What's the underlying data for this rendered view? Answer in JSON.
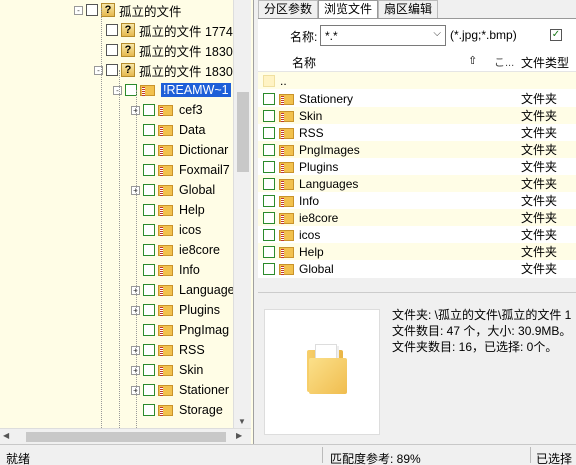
{
  "tree": {
    "items": [
      {
        "label": "孤立的文件",
        "kind": "q"
      },
      {
        "label": "孤立的文件 1774",
        "kind": "q"
      },
      {
        "label": "孤立的文件 1830",
        "kind": "q"
      },
      {
        "label": "孤立的文件 1830",
        "kind": "q"
      },
      {
        "label": "!REAMW~1",
        "kind": "folder",
        "selected": true
      },
      {
        "label": "cef3",
        "kind": "folder"
      },
      {
        "label": "Data",
        "kind": "folder"
      },
      {
        "label": "Dictionar",
        "kind": "folder"
      },
      {
        "label": "Foxmail7",
        "kind": "folder"
      },
      {
        "label": "Global",
        "kind": "folder"
      },
      {
        "label": "Help",
        "kind": "folder"
      },
      {
        "label": "icos",
        "kind": "folder"
      },
      {
        "label": "ie8core",
        "kind": "folder"
      },
      {
        "label": "Info",
        "kind": "folder"
      },
      {
        "label": "Language",
        "kind": "folder"
      },
      {
        "label": "Plugins",
        "kind": "folder"
      },
      {
        "label": "PngImag",
        "kind": "folder"
      },
      {
        "label": "RSS",
        "kind": "folder"
      },
      {
        "label": "Skin",
        "kind": "folder"
      },
      {
        "label": "Stationer",
        "kind": "folder"
      },
      {
        "label": "Storage",
        "kind": "folder"
      }
    ]
  },
  "tabs": [
    {
      "label": "分区参数",
      "active": false
    },
    {
      "label": "浏览文件",
      "active": true
    },
    {
      "label": "扇区编辑",
      "active": false
    }
  ],
  "filter": {
    "label": "名称:",
    "value": "*.*",
    "hint": "(*.jpg;*.bmp)"
  },
  "list": {
    "columns": {
      "name": "名称",
      "truncated": "こ...",
      "type": "文件类型"
    },
    "parent": "..",
    "rows": [
      {
        "name": "Stationery",
        "type": "文件夹"
      },
      {
        "name": "Skin",
        "type": "文件夹"
      },
      {
        "name": "RSS",
        "type": "文件夹"
      },
      {
        "name": "PngImages",
        "type": "文件夹"
      },
      {
        "name": "Plugins",
        "type": "文件夹"
      },
      {
        "name": "Languages",
        "type": "文件夹"
      },
      {
        "name": "Info",
        "type": "文件夹"
      },
      {
        "name": "ie8core",
        "type": "文件夹"
      },
      {
        "name": "icos",
        "type": "文件夹"
      },
      {
        "name": "Help",
        "type": "文件夹"
      },
      {
        "name": "Global",
        "type": "文件夹"
      }
    ]
  },
  "info": {
    "line1": "文件夹: \\孤立的文件\\孤立的文件 1",
    "line2": "文件数目: 47 个，大小: 30.9MB。",
    "line3": "文件夹数目: 16，已选择: 0个。"
  },
  "status": {
    "left": "就绪",
    "middle": "匹配度参考: 89%",
    "right": "已选择"
  }
}
